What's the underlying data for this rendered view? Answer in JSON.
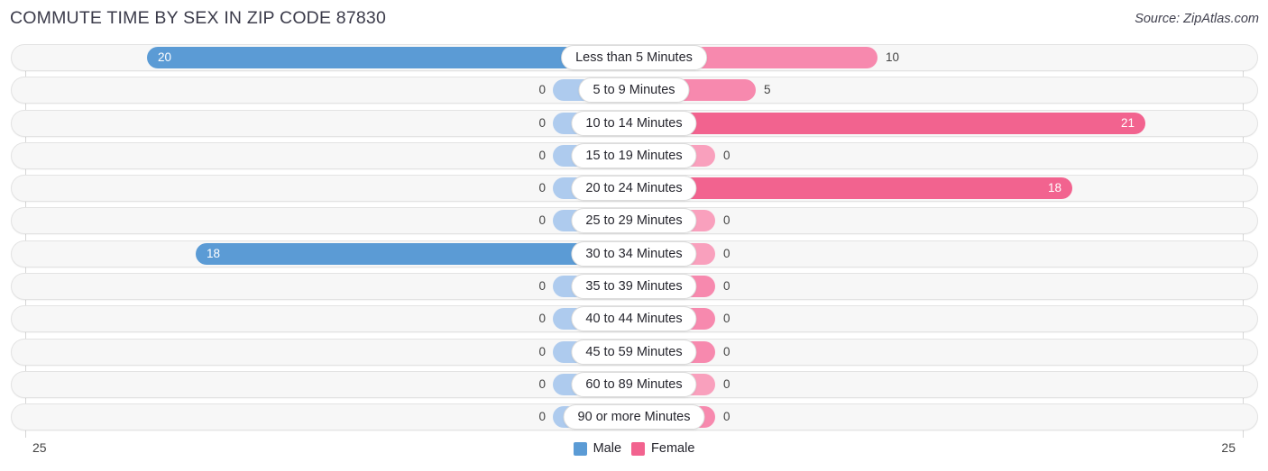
{
  "header": {
    "title": "COMMUTE TIME BY SEX IN ZIP CODE 87830",
    "source": "Source: ZipAtlas.com"
  },
  "axis": {
    "left_tick": "25",
    "right_tick": "25"
  },
  "legend": {
    "items": [
      {
        "label": "Male",
        "color": "#5b9bd5"
      },
      {
        "label": "Female",
        "color": "#f2638f"
      }
    ]
  },
  "colors": {
    "male_strong": "#5b9bd5",
    "male_faint": "#aecbee",
    "female_strong": "#f2638f",
    "female_mid": "#f789ae",
    "female_faint": "#f9a0bd",
    "track": "#f7f7f7",
    "track_border": "#e3e3e3"
  },
  "chart_data": {
    "type": "bar",
    "title": "COMMUTE TIME BY SEX IN ZIP CODE 87830",
    "orientation": "horizontal-diverging",
    "xlabel": "",
    "ylabel": "",
    "xlim": [
      -25,
      25
    ],
    "axis_ticks": [
      "25",
      "25"
    ],
    "grid": false,
    "legend_position": "bottom-center",
    "categories": [
      "Less than 5 Minutes",
      "5 to 9 Minutes",
      "10 to 14 Minutes",
      "15 to 19 Minutes",
      "20 to 24 Minutes",
      "25 to 29 Minutes",
      "30 to 34 Minutes",
      "35 to 39 Minutes",
      "40 to 44 Minutes",
      "45 to 59 Minutes",
      "60 to 89 Minutes",
      "90 or more Minutes"
    ],
    "series": [
      {
        "name": "Male",
        "values": [
          20,
          0,
          0,
          0,
          0,
          0,
          18,
          0,
          0,
          0,
          0,
          0
        ]
      },
      {
        "name": "Female",
        "values": [
          10,
          5,
          21,
          0,
          18,
          0,
          0,
          0,
          0,
          0,
          0,
          0
        ]
      }
    ]
  },
  "rows": [
    {
      "label": "Less than 5 Minutes",
      "male": "20",
      "female": "10",
      "male_inside": true,
      "female_inside": false,
      "male_color": "#5b9bd5",
      "female_color": "#f789ae"
    },
    {
      "label": "5 to 9 Minutes",
      "male": "0",
      "female": "5",
      "male_inside": false,
      "female_inside": false,
      "male_color": "#aecbee",
      "female_color": "#f789ae"
    },
    {
      "label": "10 to 14 Minutes",
      "male": "0",
      "female": "21",
      "male_inside": false,
      "female_inside": true,
      "male_color": "#aecbee",
      "female_color": "#f2638f"
    },
    {
      "label": "15 to 19 Minutes",
      "male": "0",
      "female": "0",
      "male_inside": false,
      "female_inside": false,
      "male_color": "#aecbee",
      "female_color": "#f9a0bd"
    },
    {
      "label": "20 to 24 Minutes",
      "male": "0",
      "female": "18",
      "male_inside": false,
      "female_inside": true,
      "male_color": "#aecbee",
      "female_color": "#f2638f"
    },
    {
      "label": "25 to 29 Minutes",
      "male": "0",
      "female": "0",
      "male_inside": false,
      "female_inside": false,
      "male_color": "#aecbee",
      "female_color": "#f9a0bd"
    },
    {
      "label": "30 to 34 Minutes",
      "male": "18",
      "female": "0",
      "male_inside": true,
      "female_inside": false,
      "male_color": "#5b9bd5",
      "female_color": "#f9a0bd"
    },
    {
      "label": "35 to 39 Minutes",
      "male": "0",
      "female": "0",
      "male_inside": false,
      "female_inside": false,
      "male_color": "#aecbee",
      "female_color": "#f789ae"
    },
    {
      "label": "40 to 44 Minutes",
      "male": "0",
      "female": "0",
      "male_inside": false,
      "female_inside": false,
      "male_color": "#aecbee",
      "female_color": "#f789ae"
    },
    {
      "label": "45 to 59 Minutes",
      "male": "0",
      "female": "0",
      "male_inside": false,
      "female_inside": false,
      "male_color": "#aecbee",
      "female_color": "#f789ae"
    },
    {
      "label": "60 to 89 Minutes",
      "male": "0",
      "female": "0",
      "male_inside": false,
      "female_inside": false,
      "male_color": "#aecbee",
      "female_color": "#f9a0bd"
    },
    {
      "label": "90 or more Minutes",
      "male": "0",
      "female": "0",
      "male_inside": false,
      "female_inside": false,
      "male_color": "#aecbee",
      "female_color": "#f789ae"
    }
  ]
}
